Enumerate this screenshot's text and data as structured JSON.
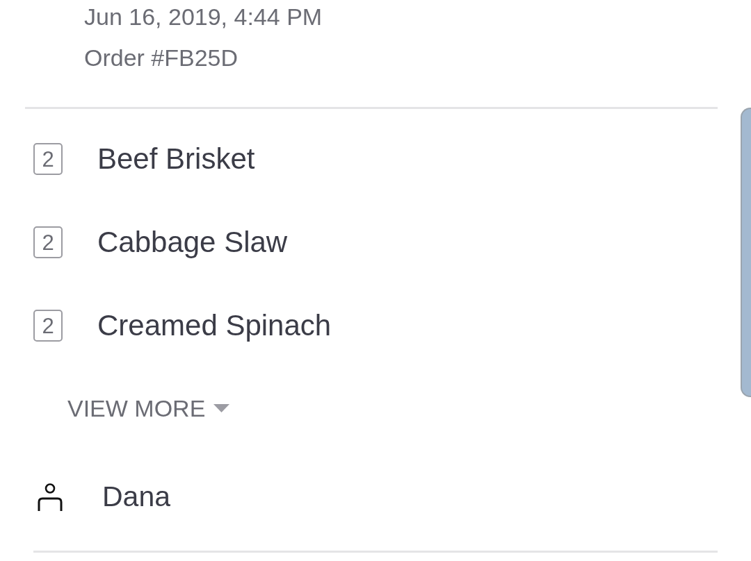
{
  "order": {
    "datetime": "Jun 16, 2019, 4:44 PM",
    "number": "Order #FB25D"
  },
  "items": [
    {
      "quantity": "2",
      "name": "Beef Brisket"
    },
    {
      "quantity": "2",
      "name": "Cabbage Slaw"
    },
    {
      "quantity": "2",
      "name": "Creamed Spinach"
    }
  ],
  "view_more": {
    "label": "VIEW MORE",
    "expanded": false
  },
  "customer": {
    "name": "Dana"
  }
}
